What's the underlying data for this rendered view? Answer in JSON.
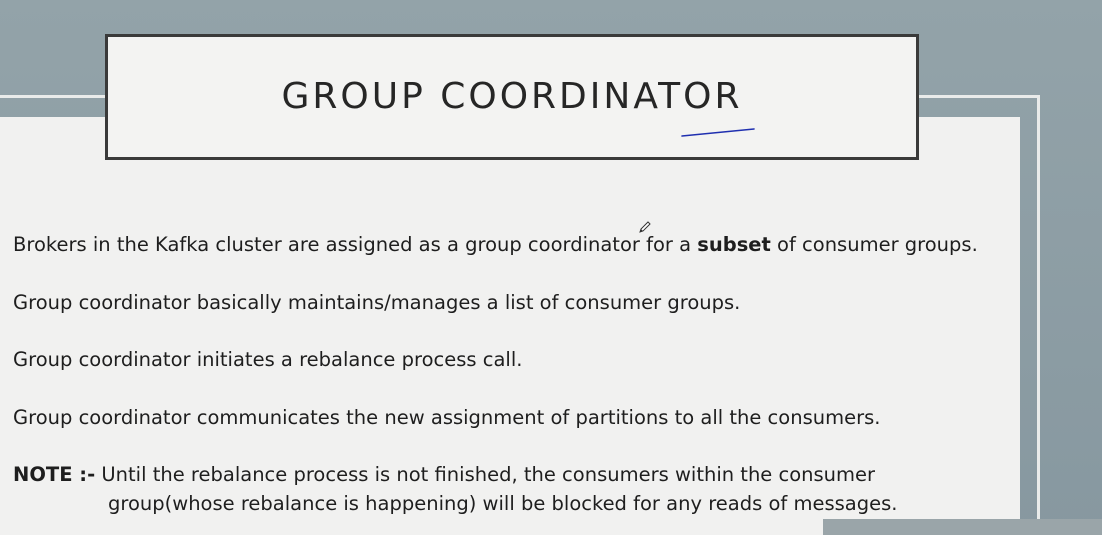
{
  "slide": {
    "title": "GROUP COORDINATOR",
    "bullets": {
      "b1_before": "Brokers in the Kafka cluster are assigned as a group coordinator for a ",
      "b1_bold": "subset",
      "b1_after": " of consumer groups.",
      "b2": "Group coordinator basically maintains/manages a list of consumer groups.",
      "b3": "Group coordinator initiates a rebalance process call.",
      "b4": "Group coordinator communicates the new assignment of partitions to all the consumers."
    },
    "note": {
      "label": "NOTE :-",
      "line1": " Until the rebalance process is not finished, the consumers within the consumer",
      "line2": "group(whose rebalance is happening) will be blocked for any reads of messages."
    }
  },
  "colors": {
    "background": "#8c9ca2",
    "panel": "#f1f1f0",
    "pen_ink": "#1f2fb0"
  },
  "icons": {
    "cursor": "pencil-icon"
  }
}
